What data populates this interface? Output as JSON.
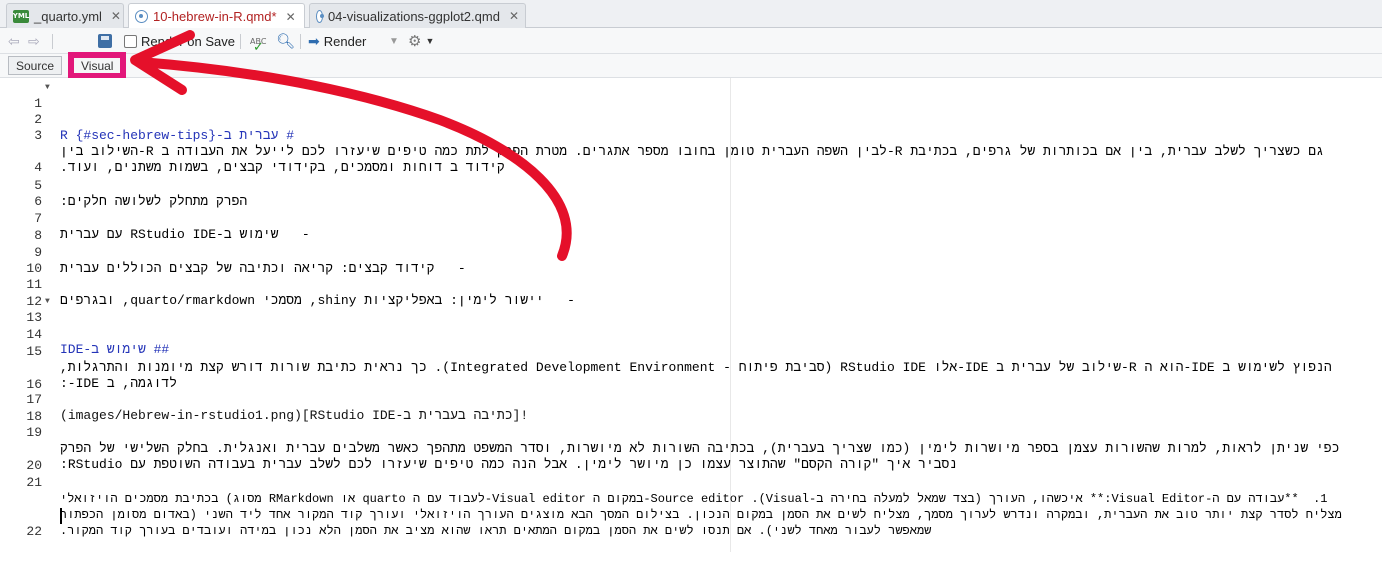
{
  "tabs": [
    {
      "label": "_quarto.yml",
      "icon": "yaml-file-icon",
      "active": false
    },
    {
      "label": "10-hebrew-in-R.qmd*",
      "icon": "quarto-file-icon",
      "active": true,
      "modified": true
    },
    {
      "label": "04-visualizations-ggplot2.qmd",
      "icon": "quarto-file-icon",
      "active": false
    }
  ],
  "toolbar": {
    "render_on_save_label": "Render on Save",
    "render_label": "Render"
  },
  "modes": {
    "source_label": "Source",
    "visual_label": "Visual"
  },
  "editor": {
    "lines": [
      {
        "n": "1",
        "text": "# עברית ב-R {#sec-hebrew-tips}"
      },
      {
        "n": "2",
        "text": ""
      },
      {
        "n": "3",
        "text": "גם כשצריך לשלב עברית, בין אם בכותרות של גרפים, בכתיבת R-לבין השפה העברית טומן בחובו מספר אתגרים. מטרת הפרק לתת כמה טיפים שיעזרו לכם לייעל את העבודה ב R-השילוב בין קידוד ב דוחות ומסמכים, בקידודי קבצים, בשמות משתנים, ועוד."
      },
      {
        "n": "4",
        "text": ""
      },
      {
        "n": "5",
        "text": "הפרק מתחלק לשלושה חלקים:"
      },
      {
        "n": "6",
        "text": ""
      },
      {
        "n": "7",
        "text": "-   שימוש ב-RStudio IDE עם עברית"
      },
      {
        "n": "8",
        "text": ""
      },
      {
        "n": "9",
        "text": "-   קידוד קבצים: קריאה וכתיבה של קבצים הכוללים עברית"
      },
      {
        "n": "10",
        "text": ""
      },
      {
        "n": "11",
        "text": "-   יישור לימין: באפליקציות shiny, מסמכי quarto/rmarkdown, ובגרפים"
      },
      {
        "n": "12",
        "text": ""
      },
      {
        "n": "13",
        "text": "## שימוש ב-IDE"
      },
      {
        "n": "14",
        "text": ""
      },
      {
        "n": "15",
        "text": "הנפוץ לשימוש ב IDE-הוא ה R-שילוב של עברית ב IDE-אלו RStudio IDE (סביבת פיתוח - Integrated Development Environment). כך נראית כתיבת שורות דורש קצת מיומנות והתרגלות, לדוגמה, ב IDE-:"
      },
      {
        "n": "16",
        "text": ""
      },
      {
        "n": "17",
        "text": "![כתיבה בעברית ב-RStudio IDE](images/Hebrew-in-rstudio1.png)"
      },
      {
        "n": "18",
        "text": ""
      },
      {
        "n": "19",
        "text": "כפי שניתן לראות, למרות שהשורות עצמן בספר מיושרות לימין (כמו שצריך בעברית), בכתיבה השורות לא מיושרות, וסדר המשפט מתהפך כאשר משלבים עברית ואנגלית. בחלק השלישי של הפרק נסביר איך \"קורה הקסם\" שהתוצר עצמו כן מיושר לימין. אבל הנה כמה טיפים שיעזרו לכם לשלב עברית בעבודה השוטפת עם RStudio:"
      },
      {
        "n": "20",
        "text": ""
      },
      {
        "n": "21",
        "text": "1.  **עבודה עם ה-Visual Editor:** איכשהו, העורך (בצד שמאל למעלה בחירה ב-Visual). Source editor-במקום ה Visual editor-לעבוד עם ה quarto או RMarkdown מסוג) בכתיבת מסמכים הויזואלי מצליח לסדר קצת יותר טוב את העברית, ובמקרה ונדרש לערוך מסמך, מצליח לשים את הסמן במקום הנכון. בצילום המסך הבא מוצגים העורך הויזואלי ועורך קוד המקור אחד ליד השני (באדום מסומן הכפתור שמאפשר לעבור מאחד לשני). אם תנסו לשים את הסמן במקום המתאים תראו שהוא מציב את הסמן הלא נכון במידה ועובדים בעורך קוד המקור."
      },
      {
        "n": "22",
        "text": ""
      }
    ]
  },
  "annotation_color": "#e2177a"
}
